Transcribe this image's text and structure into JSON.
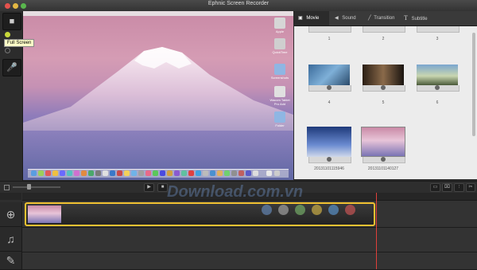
{
  "window": {
    "title": "Ephnic Screen Recorder"
  },
  "left_toolbar": {
    "tooltip": "Full Screen"
  },
  "desktop": {
    "icons": [
      "Apple",
      "QuickTime",
      "Screenshots",
      "Wacom Tablet Pro Add",
      "Folder"
    ]
  },
  "tabs": [
    {
      "label": "Movie",
      "icon": "film-icon"
    },
    {
      "label": "Sound",
      "icon": "speaker-icon"
    },
    {
      "label": "Transition",
      "icon": "transition-icon"
    },
    {
      "label": "Subtitle",
      "icon": "text-icon"
    }
  ],
  "media": {
    "top_numbers": [
      "1",
      "2",
      "3"
    ],
    "row1_labels": [
      "4",
      "5",
      "6"
    ],
    "row2_labels": [
      "20131101115946",
      "20131101140127"
    ]
  },
  "colors": {
    "accent": "#f1c232",
    "playhead": "#e0403a"
  },
  "watermark": {
    "text": "Download.com.vn"
  }
}
